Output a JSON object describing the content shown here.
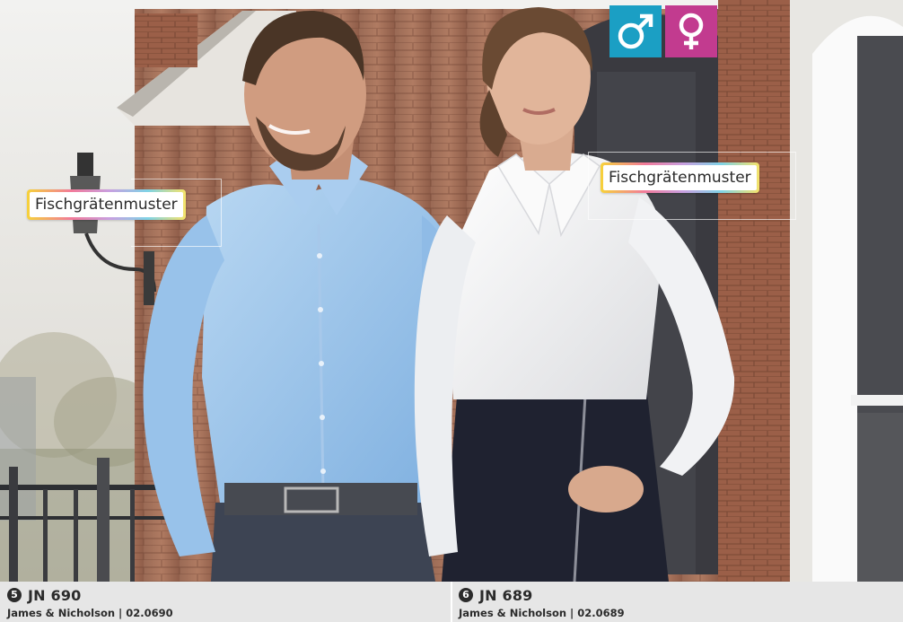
{
  "badges": {
    "male_icon": "male-symbol",
    "female_icon": "female-symbol",
    "male_color": "#1b9fc4",
    "female_color": "#c23b8f"
  },
  "tags": {
    "left": "Fischgrätenmuster",
    "right": "Fischgrätenmuster"
  },
  "products": [
    {
      "number": "5",
      "model": "JN 690",
      "brand_code": "James & Nicholson | 02.0690"
    },
    {
      "number": "6",
      "model": "JN 689",
      "brand_code": "James & Nicholson | 02.0689"
    }
  ]
}
